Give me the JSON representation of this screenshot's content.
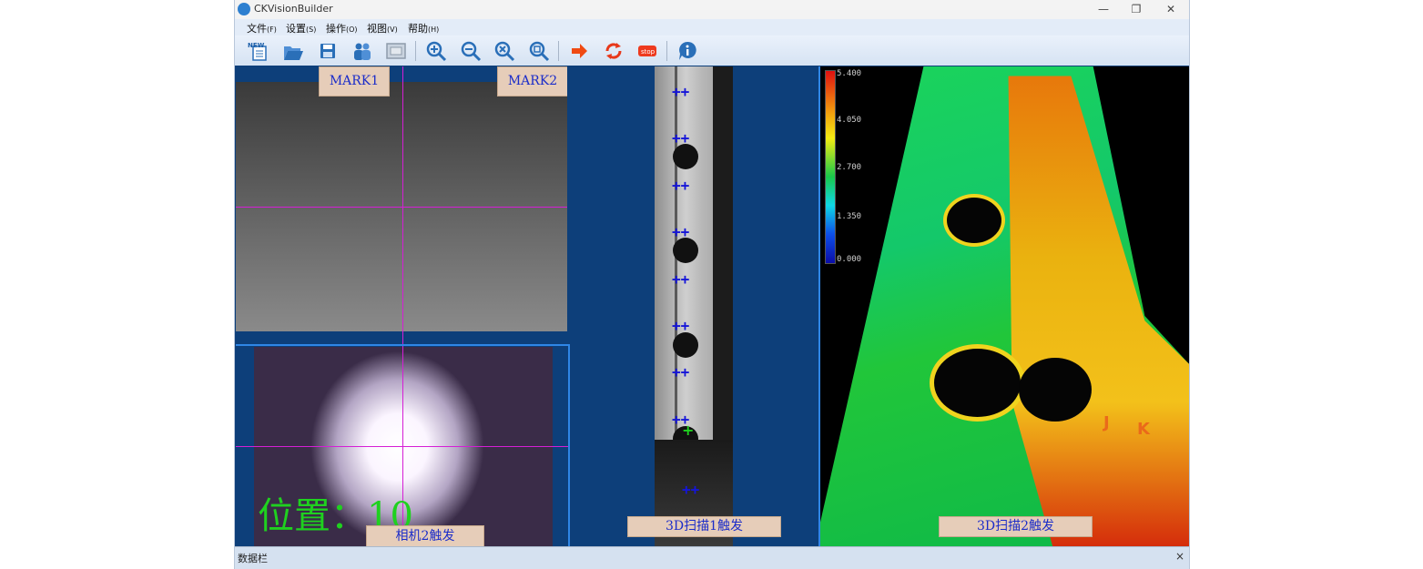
{
  "window": {
    "title": "CKVisionBuilder",
    "controls": {
      "minimize": "—",
      "restore": "❐",
      "close": "✕"
    }
  },
  "menu": [
    {
      "label": "文件",
      "key": "(F)"
    },
    {
      "label": "设置",
      "key": "(S)"
    },
    {
      "label": "操作",
      "key": "(O)"
    },
    {
      "label": "视图",
      "key": "(V)"
    },
    {
      "label": "帮助",
      "key": "(H)"
    }
  ],
  "toolbar": {
    "icons": [
      "new-icon",
      "open-folder-icon",
      "save-icon",
      "users-icon",
      "frame-icon",
      "zoom-in-icon",
      "zoom-out-icon",
      "zoom-fit-icon",
      "zoom-actual-icon",
      "run-arrow-icon",
      "loop-icon",
      "stop-icon",
      "info-icon"
    ],
    "new_text": "NEW",
    "stop_text": "stop"
  },
  "panels": {
    "camera1": {
      "mark1": "MARK1",
      "mark2": "MARK2"
    },
    "camera2": {
      "position_label": "位置：",
      "position_value": "10",
      "trigger_label": "相机2触发"
    },
    "scan1": {
      "trigger_label": "3D扫描1触发"
    },
    "scan2": {
      "trigger_label": "3D扫描2触发",
      "colorbar_ticks": [
        "5.400",
        "4.050",
        "2.700",
        "1.350",
        "0.000"
      ],
      "part_letters": [
        "J",
        "K"
      ]
    }
  },
  "colors": {
    "crosshair": "#d51fd5",
    "label_bg": "#e6cdb9",
    "label_text": "#1b2cc9",
    "position_text": "#1fd11f",
    "background": "#0d3f7a"
  },
  "data_bar": {
    "title": "数据栏",
    "close": "×"
  }
}
